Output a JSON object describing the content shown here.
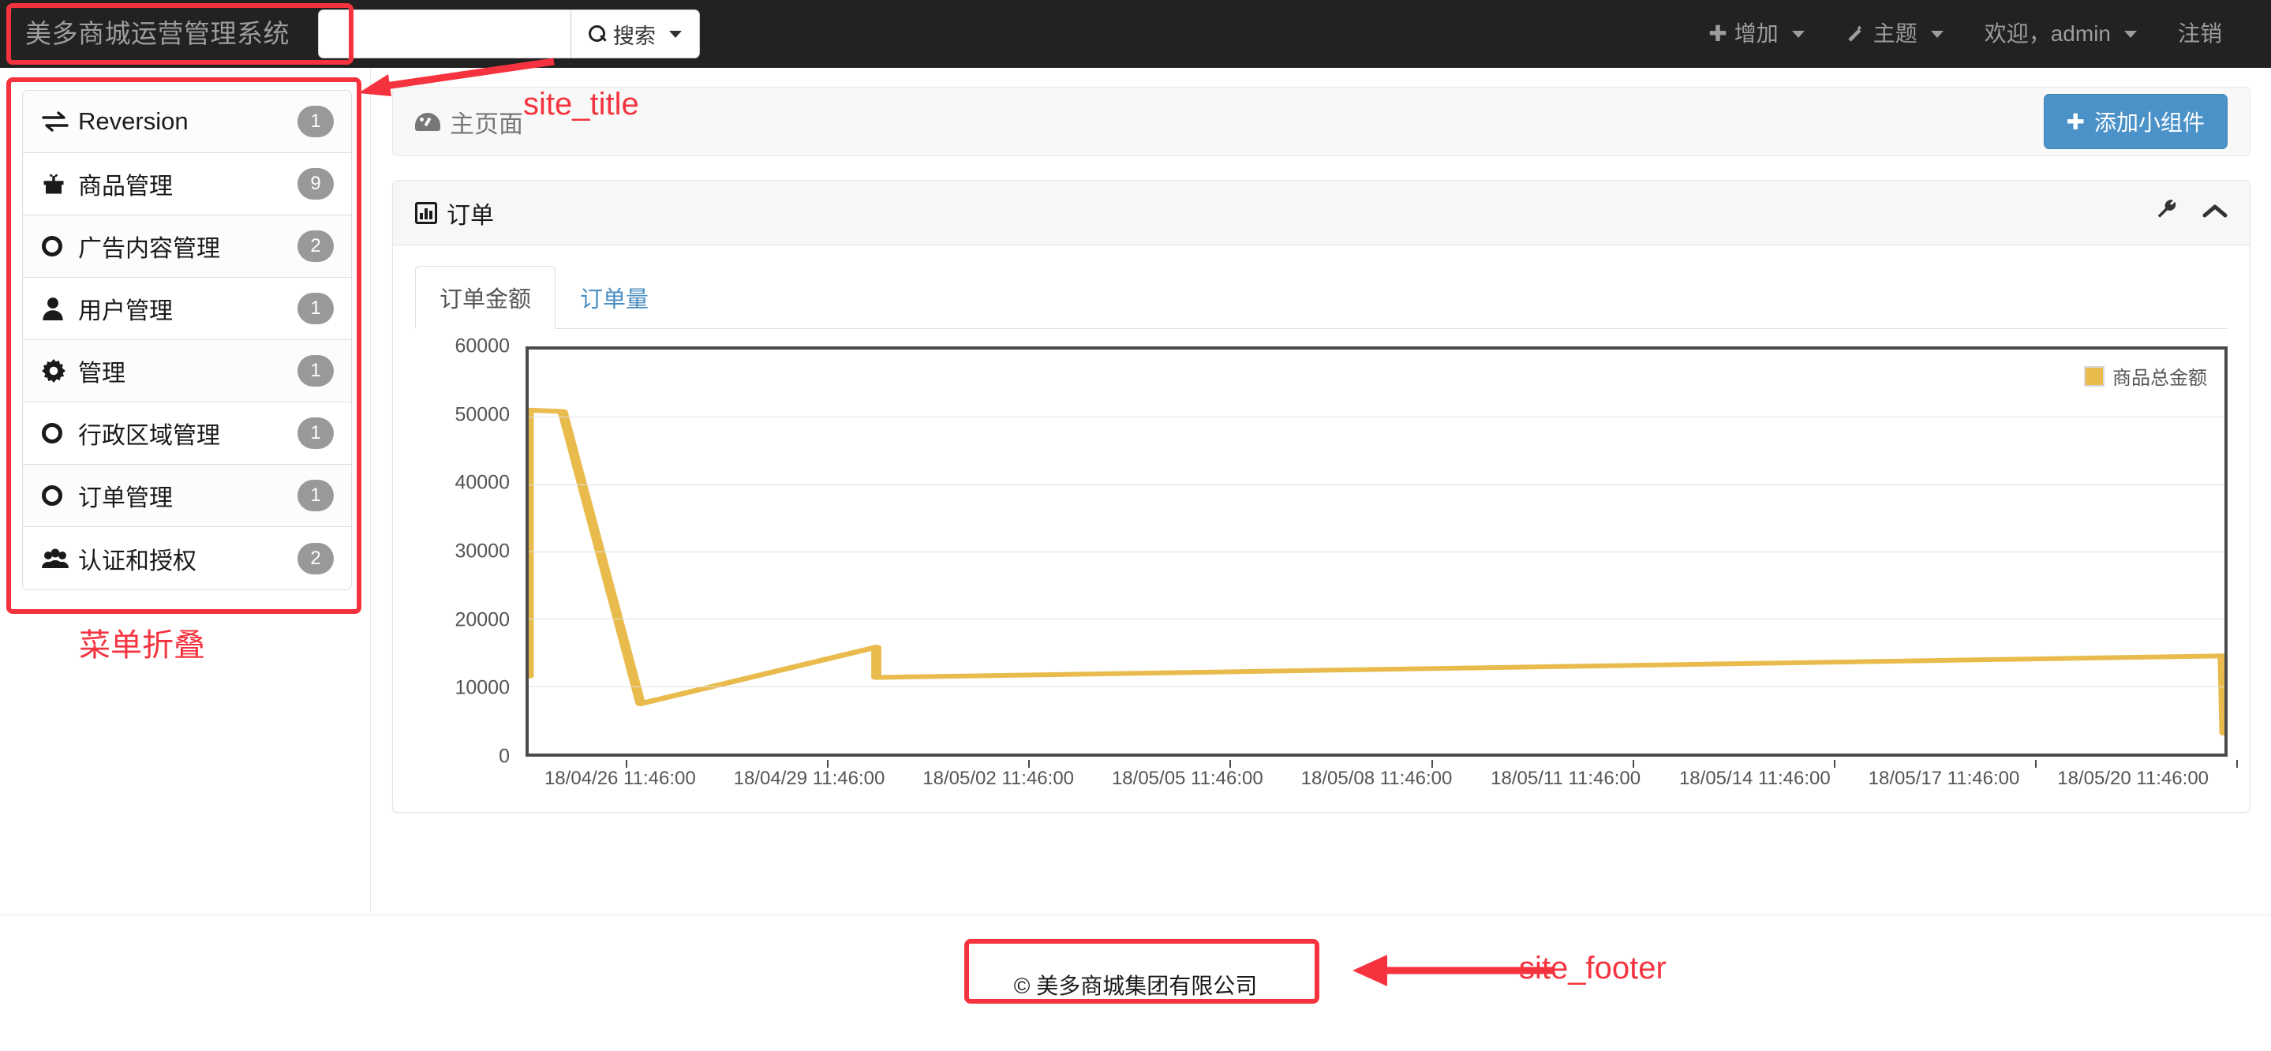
{
  "topnav": {
    "brand": "美多商城运营管理系统",
    "search": {
      "value": "",
      "placeholder": "",
      "button_label": "搜索",
      "icon": "search-icon"
    },
    "items": [
      {
        "label": "增加",
        "icon": "plus-icon",
        "has_caret": true
      },
      {
        "label": "主题",
        "icon": "magic-wand-icon",
        "has_caret": true
      },
      {
        "label": "欢迎，admin",
        "icon": "",
        "has_caret": true
      },
      {
        "label": "注销",
        "icon": "",
        "has_caret": false
      }
    ]
  },
  "sidebar": {
    "items": [
      {
        "label": "Reversion",
        "badge": "1",
        "icon": "exchange-icon",
        "latin": true
      },
      {
        "label": "商品管理",
        "badge": "9",
        "icon": "gift-icon",
        "latin": false
      },
      {
        "label": "广告内容管理",
        "badge": "2",
        "icon": "circle-icon",
        "latin": false
      },
      {
        "label": "用户管理",
        "badge": "1",
        "icon": "user-icon",
        "latin": false
      },
      {
        "label": "管理",
        "badge": "1",
        "icon": "gear-icon",
        "latin": false
      },
      {
        "label": "行政区域管理",
        "badge": "1",
        "icon": "circle-icon",
        "latin": false
      },
      {
        "label": "订单管理",
        "badge": "1",
        "icon": "circle-icon",
        "latin": false
      },
      {
        "label": "认证和授权",
        "badge": "2",
        "icon": "users-icon",
        "latin": false
      }
    ]
  },
  "annotations": [
    {
      "text": "site_title",
      "color": "#f5333f"
    },
    {
      "text": "菜单折叠",
      "color": "#f5333f"
    },
    {
      "text": "site_footer",
      "color": "#f5333f"
    }
  ],
  "page_header": {
    "title": "主页面",
    "icon": "dashboard-icon",
    "add_widget_label": "添加小组件"
  },
  "panel": {
    "title": "订单",
    "icon": "bar-chart-icon",
    "tools": [
      {
        "name": "wrench-icon"
      },
      {
        "name": "chevron-up-icon"
      }
    ],
    "tabs": [
      {
        "label": "订单金额",
        "active": true
      },
      {
        "label": "订单量",
        "active": false
      }
    ]
  },
  "footer": {
    "text": "© 美多商城集团有限公司"
  },
  "colors": {
    "brand_bar": "#222222",
    "accent_blue": "#4a92c8",
    "series_gold": "#e8bb4c",
    "annotation_red": "#f5333f",
    "badge_gray": "#999999"
  },
  "chart_data": {
    "type": "line",
    "title": "订单金额",
    "xlabel": "",
    "ylabel": "",
    "ylim": [
      0,
      60000
    ],
    "y_ticks": [
      0,
      10000,
      20000,
      30000,
      40000,
      50000,
      60000
    ],
    "y_tick_labels": [
      "0",
      "10000",
      "20000",
      "30000",
      "40000",
      "50000",
      "60000"
    ],
    "grid": true,
    "legend_position": "top-right",
    "x_tick_labels": [
      "18/04/26 11:46:00",
      "18/04/29 11:46:00",
      "18/05/02 11:46:00",
      "18/05/05 11:46:00",
      "18/05/08 11:46:00",
      "18/05/11 11:46:00",
      "18/05/14 11:46:00",
      "18/05/17 11:46:00",
      "18/05/20 11:46:00"
    ],
    "series": [
      {
        "name": "商品总金额",
        "color": "#e8bb4c",
        "x_frac": [
          0.0,
          0.0,
          0.02,
          0.066,
          0.205,
          0.205,
          0.999,
          1.0
        ],
        "values": [
          11500,
          51000,
          50800,
          7400,
          15800,
          11300,
          14500,
          3000
        ]
      }
    ]
  }
}
